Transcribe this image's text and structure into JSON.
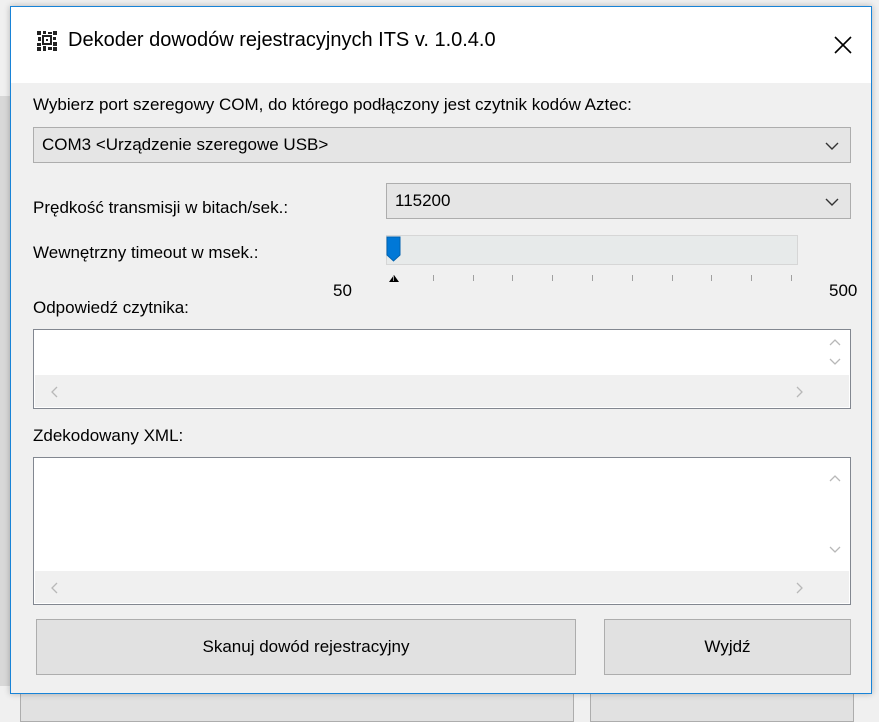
{
  "window": {
    "title": "Dekoder dowodów rejestracyjnych ITS v. 1.0.4.0"
  },
  "port": {
    "label": "Wybierz port szeregowy COM, do którego podłączony jest czytnik kodów Aztec:",
    "selected": "COM3 <Urządzenie szeregowe USB>"
  },
  "baud": {
    "label": "Prędkość transmisji w bitach/sek.:",
    "selected": "115200"
  },
  "timeout": {
    "label": "Wewnętrzny timeout w msek.:",
    "min_label": "50",
    "max_label": "500",
    "value": 50,
    "min": 50,
    "max": 500
  },
  "reader_response": {
    "label": "Odpowiedź czytnika:",
    "value": ""
  },
  "decoded_xml": {
    "label": "Zdekodowany XML:",
    "value": ""
  },
  "buttons": {
    "scan": "Skanuj dowód rejestracyjny",
    "exit": "Wyjdź"
  },
  "colors": {
    "accent": "#0078d7",
    "window_border": "#1883d7"
  }
}
